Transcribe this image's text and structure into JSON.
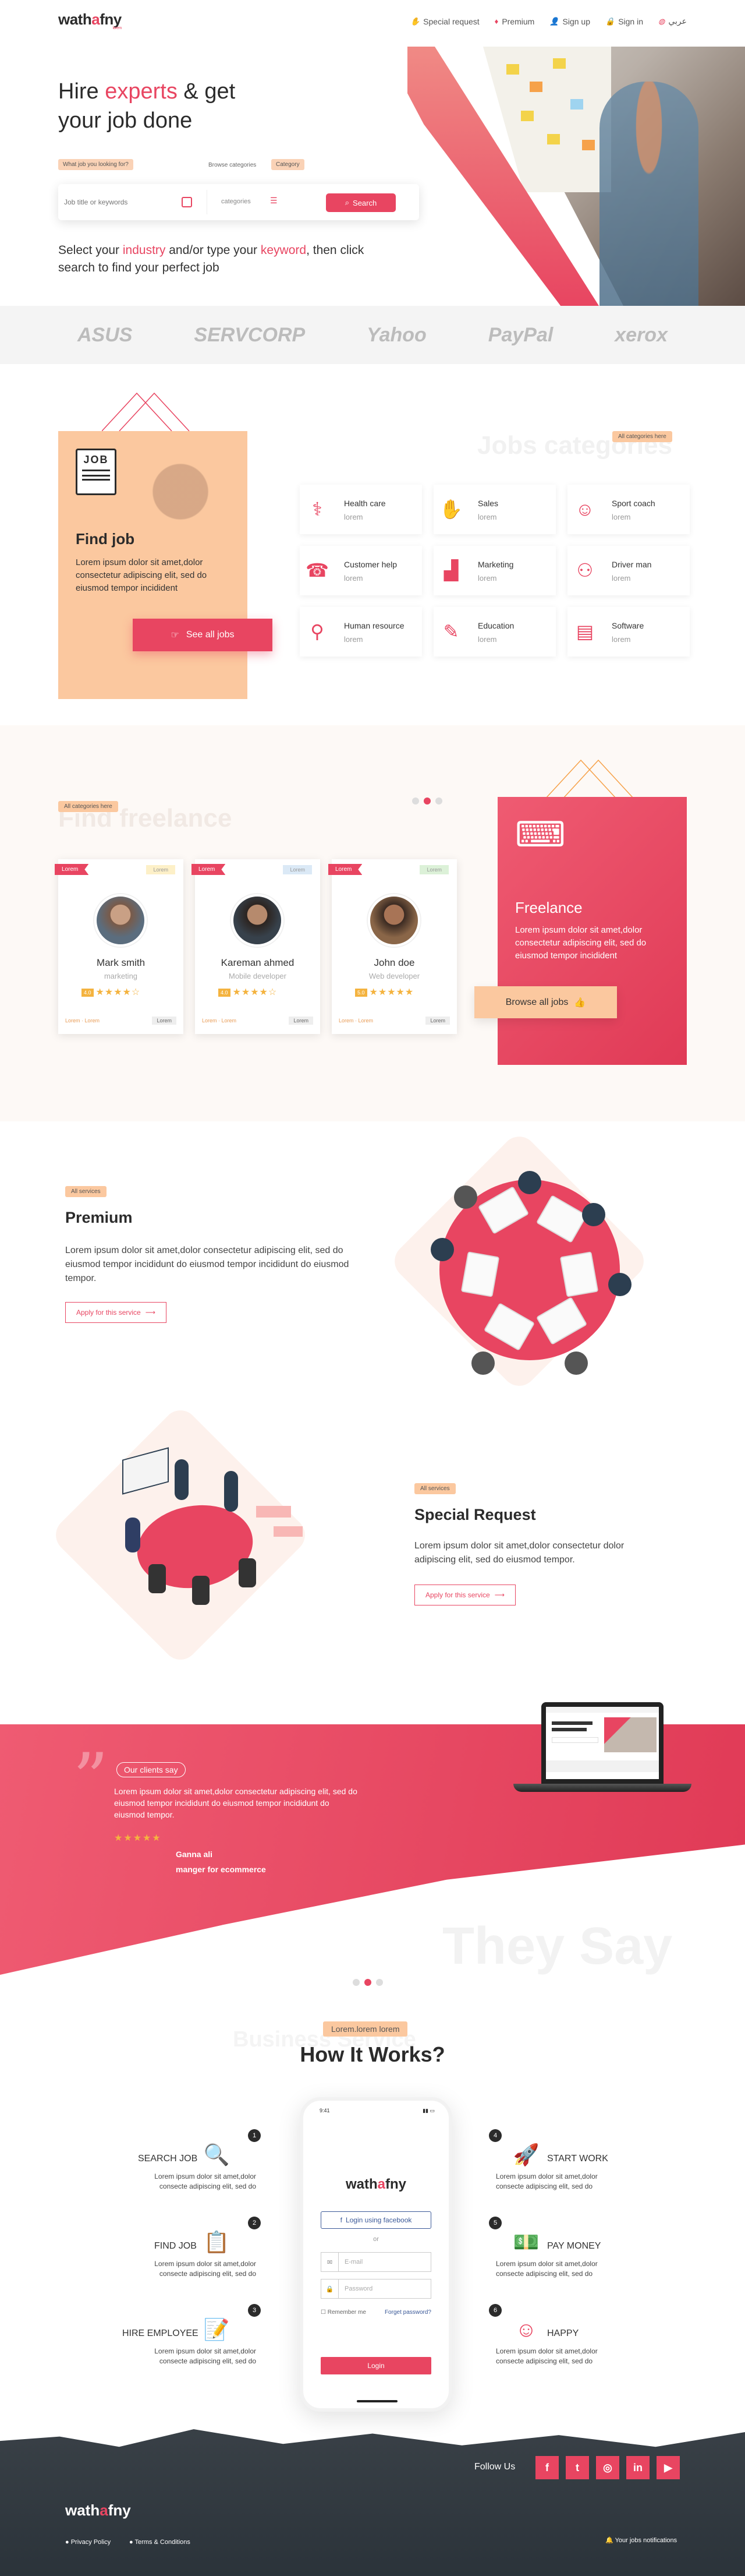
{
  "brand": {
    "logo_main": "wath",
    "logo_accent": "a",
    "logo_tail": "fny",
    "tagline": "lorem"
  },
  "nav": {
    "special_request": "Special request",
    "premium": "Premium",
    "sign_up": "Sign up",
    "sign_in": "Sign in",
    "language": "عربي"
  },
  "hero": {
    "title_1": "Hire ",
    "title_accent": "experts",
    "title_2": " & get",
    "title_3": "your job done",
    "label_looking": "What job you looking for?",
    "label_browse": "Browse categories",
    "label_category": "Category",
    "search_placeholder": "Job title or keywords",
    "categories_placeholder": "categories",
    "search_button": "Search",
    "sub_1": "Select your ",
    "sub_industry": "industry",
    "sub_2": " and/or type your ",
    "sub_keyword": "keyword",
    "sub_3": ", then click",
    "sub_4": "search to find your perfect job"
  },
  "brands": [
    "ASUS",
    "SERVCORP",
    "Yahoo",
    "PayPal",
    "xerox"
  ],
  "jobs": {
    "icon_label": "JOB",
    "title": "Find job",
    "desc": "Lorem ipsum dolor sit amet,dolor consectetur adipiscing elit, sed do eiusmod tempor incidident",
    "button": "See all jobs",
    "section_title": "Jobs categories",
    "tag": "All categories here",
    "categories": [
      {
        "name": "Health care",
        "sub": "lorem",
        "icon": "health-icon"
      },
      {
        "name": "Sales",
        "sub": "lorem",
        "icon": "sales-icon"
      },
      {
        "name": "Sport coach",
        "sub": "lorem",
        "icon": "coach-icon"
      },
      {
        "name": "Customer help",
        "sub": "lorem",
        "icon": "customer-icon"
      },
      {
        "name": "Marketing",
        "sub": "lorem",
        "icon": "chart-icon"
      },
      {
        "name": "Driver man",
        "sub": "lorem",
        "icon": "driver-icon"
      },
      {
        "name": "Human resource",
        "sub": "lorem",
        "icon": "hr-icon"
      },
      {
        "name": "Education",
        "sub": "lorem",
        "icon": "education-icon"
      },
      {
        "name": "Software",
        "sub": "lorem",
        "icon": "software-icon"
      }
    ]
  },
  "freelance": {
    "section_title": "Find freelance",
    "tag": "All categories here",
    "cards": [
      {
        "ribbon": "Lorem",
        "badge": "Lorem",
        "name": "Mark smith",
        "role": "marketing",
        "rating": "4.0",
        "stars": "★★★★☆",
        "footer_left": "Lorem · Lorem",
        "footer_right": "Lorem"
      },
      {
        "ribbon": "Lorem",
        "badge": "Lorem",
        "name": "Kareman ahmed",
        "role": "Mobile developer",
        "rating": "4.0",
        "stars": "★★★★☆",
        "footer_left": "Lorem · Lorem",
        "footer_right": "Lorem"
      },
      {
        "ribbon": "Lorem",
        "badge": "Lorem",
        "name": "John doe",
        "role": "Web developer",
        "rating": "5.0",
        "stars": "★★★★★",
        "footer_left": "Lorem · Lorem",
        "footer_right": "Lorem"
      }
    ],
    "red_title": "Freelance",
    "red_desc": "Lorem ipsum dolor sit amet,dolor consectetur adipiscing elit, sed do eiusmod tempor incidident",
    "button": "Browse all jobs"
  },
  "premium": {
    "tag": "All services",
    "title": "Premium",
    "desc": "Lorem ipsum dolor sit amet,dolor  consectetur adipiscing elit, sed do eiusmod tempor incididunt do eiusmod tempor incididunt do eiusmod tempor.",
    "button": "Apply for this service"
  },
  "special": {
    "tag": "All services",
    "title": "Special Request",
    "desc": "Lorem ipsum dolor sit amet,dolor  consectetur dolor adipiscing elit, sed do eiusmod tempor.",
    "button": "Apply for this service"
  },
  "testimonial": {
    "tag": "Our clients say",
    "text": "Lorem ipsum dolor sit amet,dolor  consectetur adipiscing elit, sed do eiusmod tempor incididunt do eiusmod tempor incididunt do eiusmod tempor.",
    "stars": "★★★★★",
    "name": "Ganna ali",
    "role": "manger for ecommerce",
    "bg_word": "They Say"
  },
  "how": {
    "tag": "Lorem.lorem lorem",
    "bg_word": "Business Service",
    "title": "How It Works?",
    "steps": [
      {
        "num": "1",
        "name": "SEARCH JOB",
        "desc": "Lorem ipsum dolor sit amet,dolor  consecte adipiscing elit, sed do",
        "icon": "search-job-icon"
      },
      {
        "num": "2",
        "name": "FIND JOB",
        "desc": "Lorem ipsum dolor sit amet,dolor  consecte adipiscing elit, sed do",
        "icon": "clipboard-icon"
      },
      {
        "num": "3",
        "name": "HIRE EMPLOYEE",
        "desc": "Lorem ipsum dolor sit amet,dolor  consecte adipiscing elit, sed do",
        "icon": "contract-icon"
      },
      {
        "num": "4",
        "name": "START WORK",
        "desc": "Lorem ipsum dolor sit amet,dolor  consecte adipiscing elit, sed do",
        "icon": "rocket-icon"
      },
      {
        "num": "5",
        "name": "PAY MONEY",
        "desc": "Lorem ipsum dolor sit amet,dolor  consecte adipiscing elit, sed do",
        "icon": "money-icon"
      },
      {
        "num": "6",
        "name": "HAPPY",
        "desc": "Lorem ipsum dolor sit amet,dolor  consecte adipiscing elit, sed do",
        "icon": "smile-icon"
      }
    ],
    "phone": {
      "time": "9:41",
      "fb_button": "Login using facebook",
      "or": "or",
      "email_placeholder": "E-mail",
      "password_placeholder": "Password",
      "remember": "Remember me",
      "forgot": "Forget password?",
      "login": "Login"
    }
  },
  "footer": {
    "follow": "Follow Us",
    "social": [
      "f",
      "t",
      "◎",
      "in",
      "▶"
    ],
    "privacy": "Privacy Policy",
    "terms": "Terms & Conditions",
    "notifications": "Your jobs notifications"
  }
}
